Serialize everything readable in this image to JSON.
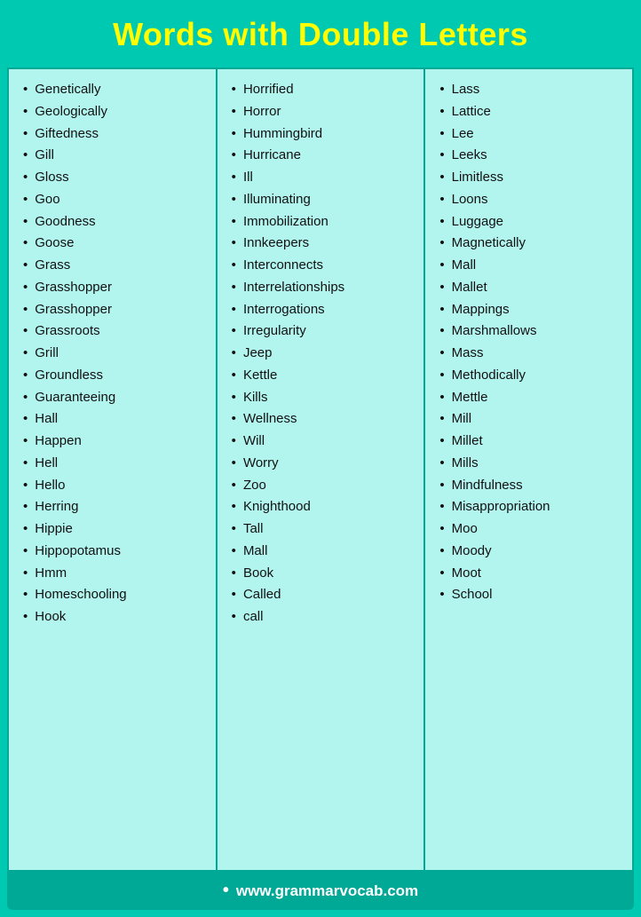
{
  "header": {
    "title": "Words with Double Letters"
  },
  "columns": [
    {
      "words": [
        "Genetically",
        "Geologically",
        "Giftedness",
        "Gill",
        "Gloss",
        "Goo",
        "Goodness",
        "Goose",
        "Grass",
        "Grasshopper",
        "Grasshopper",
        "Grassroots",
        "Grill",
        "Groundless",
        "Guaranteeing",
        "Hall",
        "Happen",
        "Hell",
        "Hello",
        "Herring",
        "Hippie",
        "Hippopotamus",
        "Hmm",
        "Homeschooling",
        "Hook"
      ]
    },
    {
      "words": [
        "Horrified",
        "Horror",
        "Hummingbird",
        "Hurricane",
        "Ill",
        "Illuminating",
        "Immobilization",
        "Innkeepers",
        "Interconnects",
        "Interrelationships",
        "Interrogations",
        "Irregularity",
        "Jeep",
        "Kettle",
        "Kills",
        "Wellness",
        "Will",
        "Worry",
        "Zoo",
        "Knighthood",
        "Tall",
        "Mall",
        "Book",
        "Called",
        "call"
      ]
    },
    {
      "words": [
        "Lass",
        "Lattice",
        "Lee",
        "Leeks",
        "Limitless",
        "Loons",
        "Luggage",
        "Magnetically",
        "Mall",
        "Mallet",
        "Mappings",
        "Marshmallows",
        "Mass",
        "Methodically",
        "Mettle",
        "Mill",
        "Millet",
        "Mills",
        "Mindfulness",
        "Misappropriation",
        "Moo",
        "Moody",
        "Moot",
        "School"
      ]
    }
  ],
  "footer": {
    "bullet": "•",
    "website": "www.grammarvocab.com"
  }
}
